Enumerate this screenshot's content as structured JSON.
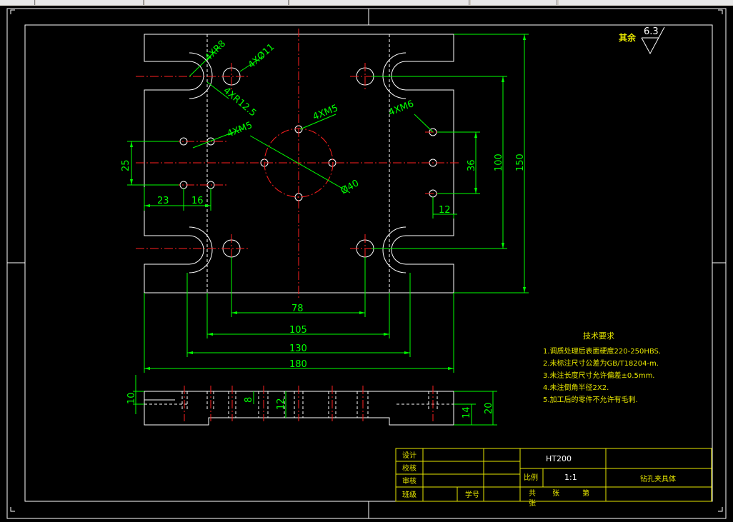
{
  "roughness_note": {
    "label": "其余",
    "value": "6.3"
  },
  "hole_labels": {
    "corner_radius": "4XR8",
    "counterbore": "4XØ11",
    "slot_radius": "4XR12.5",
    "left_thread": "4XM5",
    "center_thread": "4XM5",
    "right_thread": "4XM6",
    "circle_dia": "Ø40"
  },
  "dimensions": {
    "d25": "25",
    "d23": "23",
    "d16": "16",
    "d36": "36",
    "d100": "100",
    "d150": "150",
    "d12": "12",
    "d78": "78",
    "d105": "105",
    "d130": "130",
    "d180": "180",
    "d10": "10",
    "d8": "8",
    "d12b": "12",
    "d14": "14",
    "d20": "20"
  },
  "tech_requirements": {
    "title": "技术要求",
    "items": [
      "1.调质处理后表面硬度220-250HBS.",
      "2.未标注尺寸公差为GB/T18204-m.",
      "3.未注长度尺寸允许偏差±0.5mm.",
      "4.未注倒角半径2X2.",
      "5.加工后的零件不允许有毛刺."
    ]
  },
  "title_block": {
    "design": "设计",
    "check": "校核",
    "review": "审核",
    "class": "班级",
    "student_no": "学号",
    "material": "HT200",
    "scale_label": "比例",
    "scale_value": "1:1",
    "sheets_total": "共",
    "sheets_unit": "张",
    "sheet_no": "第",
    "sheet_unit2": "张",
    "part_name": "钻孔夹具体"
  },
  "colors": {
    "outline": "#ffffff",
    "dimension": "#00ff00",
    "centerline": "#ff2020",
    "titleblock": "#e6e600",
    "background": "#000000"
  }
}
